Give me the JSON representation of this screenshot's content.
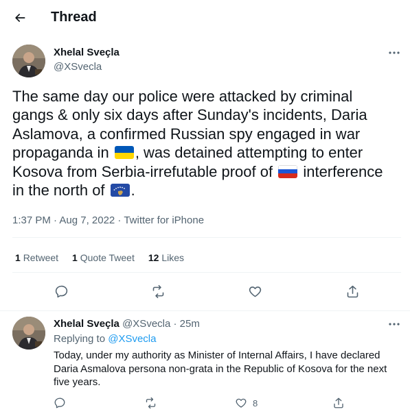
{
  "header": {
    "title": "Thread"
  },
  "main_tweet": {
    "author_name": "Xhelal Sveçla",
    "author_handle": "@XSvecla",
    "text_1": "The same day our police were attacked by criminal gangs & only six days after Sunday's incidents, Daria Aslamova, a confirmed Russian spy engaged in war propaganda in",
    "text_2": ", was detained attempting to enter Kosova from Serbia-irrefutable proof of",
    "text_3": "interference in the north of",
    "text_4": ".",
    "flags": [
      "flag-ukraine",
      "flag-russia",
      "flag-kosovo"
    ],
    "timestamp": "1:37 PM · Aug 7, 2022 · Twitter for iPhone",
    "stats": {
      "retweets_count": "1",
      "retweets_label": "Retweet",
      "quotes_count": "1",
      "quotes_label": "Quote Tweet",
      "likes_count": "12",
      "likes_label": "Likes"
    }
  },
  "reply_tweet": {
    "author_name": "Xhelal Sveçla",
    "author_handle": "@XSvecla",
    "time": "· 25m",
    "replying_prefix": "Replying to",
    "replying_handle": "@XSvecla",
    "text": "Today, under my authority as Minister of Internal Affairs, I have declared Daria Asmalova persona non-grata in the Republic of Kosova for the next five years.",
    "likes_count": "8"
  },
  "colors": {
    "text": "#0f1419",
    "secondary": "#536471",
    "accent": "#1d9bf0",
    "divider": "#eff3f4"
  }
}
